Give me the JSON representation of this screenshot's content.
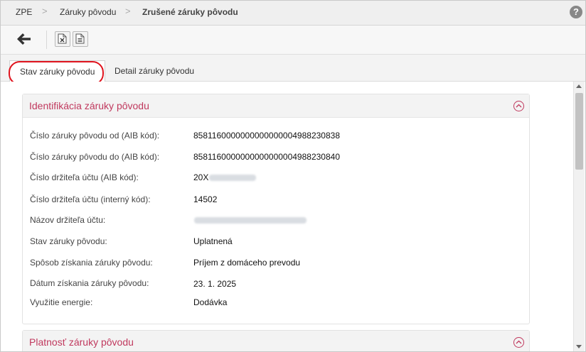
{
  "breadcrumb": {
    "items": [
      "ZPE",
      "Záruky pôvodu",
      "Zrušené záruky pôvodu"
    ],
    "separator": ">"
  },
  "help_label": "?",
  "toolbar": {
    "back_icon": "arrow-left-icon",
    "excel_icon": "excel-export-icon",
    "doc_icon": "document-export-icon"
  },
  "tabs": [
    {
      "label": "Stav záruky pôvodu",
      "active": true
    },
    {
      "label": "Detail záruky pôvodu",
      "active": false
    }
  ],
  "panels": {
    "identification": {
      "title": "Identifikácia záruky pôvodu",
      "rows": [
        {
          "label": "Číslo záruky pôvodu od (AIB kód):",
          "value": "8581160000000000000004988230838"
        },
        {
          "label": "Číslo záruky pôvodu do (AIB kód):",
          "value": "8581160000000000000004988230840"
        },
        {
          "label": "Číslo držiteľa účtu (AIB kód):",
          "value": "20X"
        },
        {
          "label": "Číslo držiteľa účtu (interný kód):",
          "value": "14502"
        },
        {
          "label": "Názov držiteľa účtu:",
          "value": ""
        },
        {
          "label": "Stav záruky pôvodu:",
          "value": "Uplatnená"
        },
        {
          "label": "Spôsob získania záruky pôvodu:",
          "value": "Príjem z domáceho prevodu"
        },
        {
          "label": "Dátum získania záruky pôvodu:",
          "value": "23. 1. 2025"
        },
        {
          "label": "Využitie energie:",
          "value": "Dodávka"
        }
      ]
    },
    "validity": {
      "title": "Platnosť záruky pôvodu"
    }
  },
  "colors": {
    "accent": "#c0395e",
    "highlight_ring": "#e0141e"
  }
}
